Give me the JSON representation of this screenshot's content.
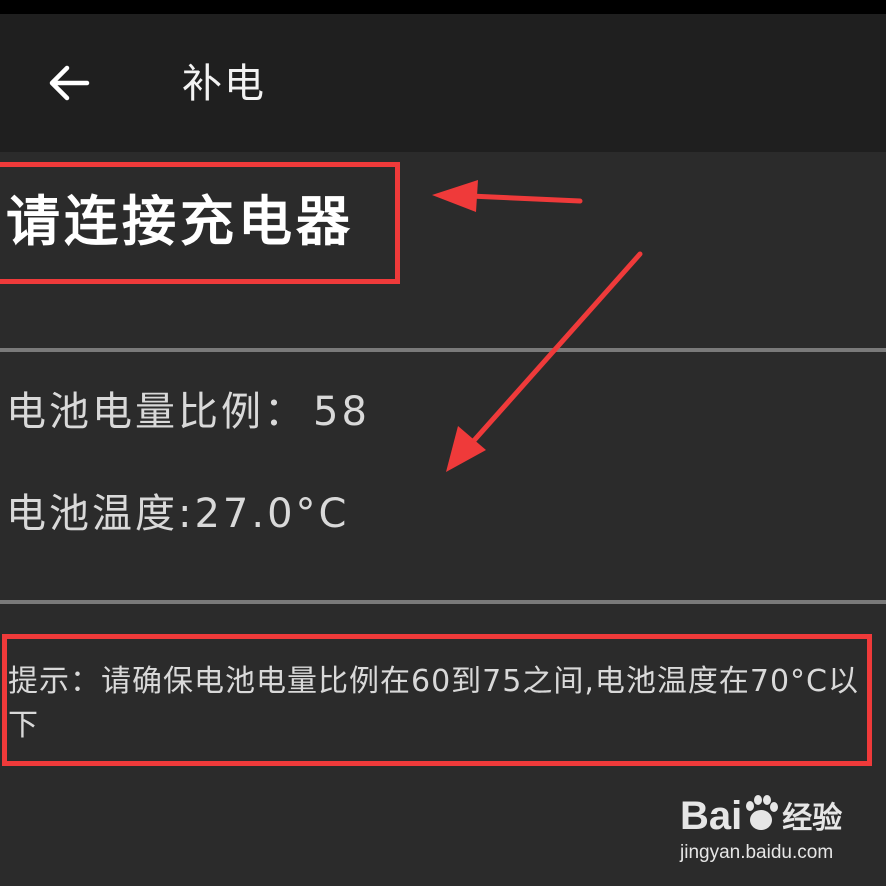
{
  "app_bar": {
    "back_icon": "arrow-left-icon",
    "title": "补电"
  },
  "charger": {
    "message": "请连接充电器"
  },
  "battery": {
    "level_label": "电池电量比例：",
    "level_value": "58",
    "temp_label": "电池温度:",
    "temp_value": "27.0°C"
  },
  "hint": {
    "text": "提示：请确保电池电量比例在60到75之间,电池温度在70°C以下"
  },
  "watermark": {
    "logo_text_1": "Bai",
    "logo_text_2": "经验",
    "url": "jingyan.baidu.com"
  },
  "colors": {
    "background": "#2b2b2b",
    "app_bar": "#1f1f1f",
    "annotation_red": "#ef3a3a",
    "text_primary": "#ffffff",
    "text_secondary": "#d9d9d9"
  }
}
